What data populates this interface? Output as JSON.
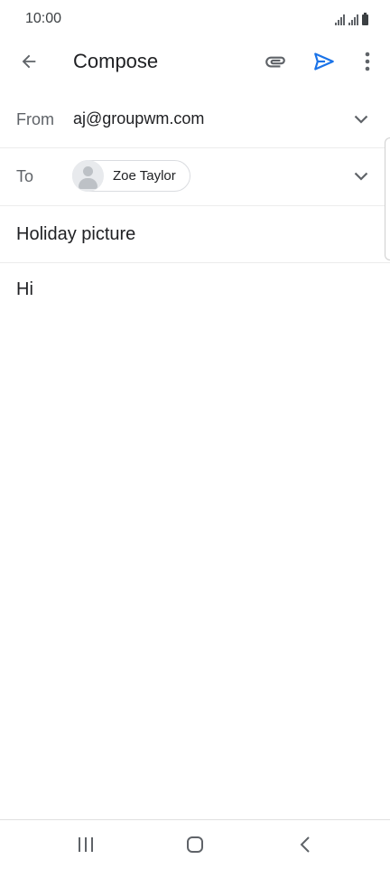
{
  "status_bar": {
    "time": "10:00"
  },
  "toolbar": {
    "back_icon": "arrow-left-icon",
    "title": "Compose",
    "attach_icon": "paperclip-icon",
    "send_icon": "send-icon",
    "send_color": "#1a73e8",
    "more_icon": "more-vertical-icon"
  },
  "from": {
    "label": "From",
    "value": "aj@groupwm.com"
  },
  "to": {
    "label": "To",
    "recipient_name": "Zoe Taylor"
  },
  "subject": {
    "value": "Holiday picture"
  },
  "body": {
    "value": "Hi"
  },
  "nav_bar": {
    "recents_icon": "recents-icon",
    "home_icon": "home-icon",
    "back_icon": "back-chevron-icon"
  }
}
